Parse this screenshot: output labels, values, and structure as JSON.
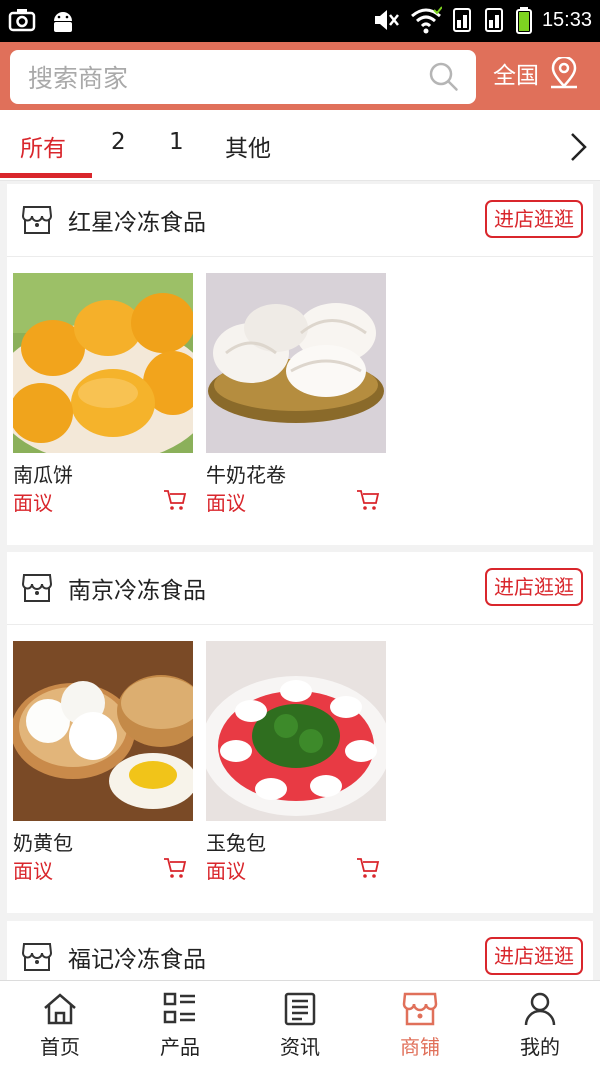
{
  "status_bar": {
    "time": "15:33"
  },
  "search": {
    "placeholder": "搜索商家",
    "value": ""
  },
  "region": {
    "label": "全国"
  },
  "tabs": [
    {
      "label": "所有",
      "active": true
    },
    {
      "label": "2",
      "active": false
    },
    {
      "label": "1",
      "active": false
    },
    {
      "label": "其他",
      "active": false
    }
  ],
  "shops": [
    {
      "name": "红星冷冻食品",
      "visit_label": "进店逛逛",
      "products": [
        {
          "name": "南瓜饼",
          "price": "面议"
        },
        {
          "name": "牛奶花卷",
          "price": "面议"
        }
      ]
    },
    {
      "name": "南京冷冻食品",
      "visit_label": "进店逛逛",
      "products": [
        {
          "name": "奶黄包",
          "price": "面议"
        },
        {
          "name": "玉兔包",
          "price": "面议"
        }
      ]
    },
    {
      "name": "福记冷冻食品",
      "visit_label": "进店逛逛",
      "products": []
    }
  ],
  "bottom_nav": [
    {
      "label": "首页",
      "icon": "home-icon",
      "active": false
    },
    {
      "label": "产品",
      "icon": "product-list-icon",
      "active": false
    },
    {
      "label": "资讯",
      "icon": "news-icon",
      "active": false
    },
    {
      "label": "商铺",
      "icon": "store-icon",
      "active": true
    },
    {
      "label": "我的",
      "icon": "user-icon",
      "active": false
    }
  ],
  "colors": {
    "header": "#e0705a",
    "accent_red": "#d9262c",
    "active_nav": "#e0705a"
  }
}
